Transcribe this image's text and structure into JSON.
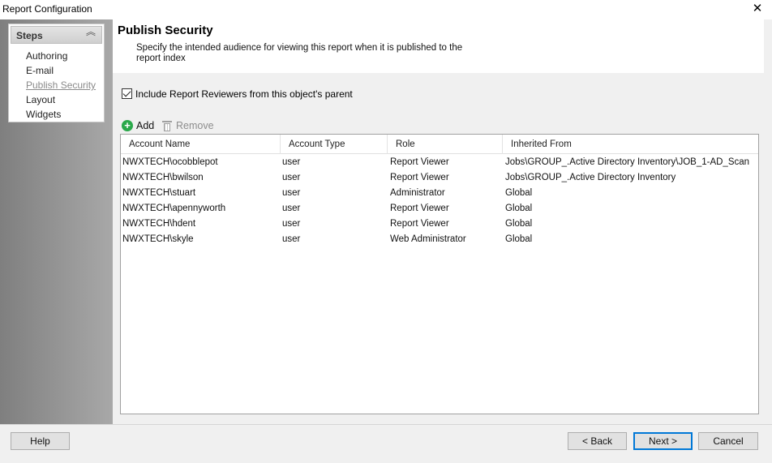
{
  "window": {
    "title": "Report Configuration",
    "close_glyph": "✕"
  },
  "steps": {
    "header": "Steps",
    "collapse_glyph": "︽",
    "items": [
      {
        "label": "Authoring",
        "active": false
      },
      {
        "label": "E-mail",
        "active": false
      },
      {
        "label": "Publish Security",
        "active": true
      },
      {
        "label": "Layout",
        "active": false
      },
      {
        "label": "Widgets",
        "active": false
      }
    ]
  },
  "page": {
    "title": "Publish Security",
    "description": "Specify the intended audience for viewing this report when it is published to the report index"
  },
  "include_reviewers": {
    "label": "Include Report Reviewers from this object's parent",
    "checked": true
  },
  "toolbar": {
    "add_label": "Add",
    "remove_label": "Remove",
    "add_glyph": "+"
  },
  "table": {
    "columns": [
      "Account Name",
      "Account Type",
      "Role",
      "Inherited From"
    ],
    "rows": [
      [
        "NWXTECH\\ocobblepot",
        "user",
        "Report Viewer",
        "Jobs\\GROUP_.Active Directory Inventory\\JOB_1-AD_Scan"
      ],
      [
        "NWXTECH\\bwilson",
        "user",
        "Report Viewer",
        "Jobs\\GROUP_.Active Directory Inventory"
      ],
      [
        "NWXTECH\\stuart",
        "user",
        "Administrator",
        "Global"
      ],
      [
        "NWXTECH\\apennyworth",
        "user",
        "Report Viewer",
        "Global"
      ],
      [
        "NWXTECH\\hdent",
        "user",
        "Report Viewer",
        "Global"
      ],
      [
        "NWXTECH\\skyle",
        "user",
        "Web Administrator",
        "Global"
      ]
    ]
  },
  "footer": {
    "help": "Help",
    "back": "< Back",
    "next": "Next >",
    "cancel": "Cancel"
  }
}
